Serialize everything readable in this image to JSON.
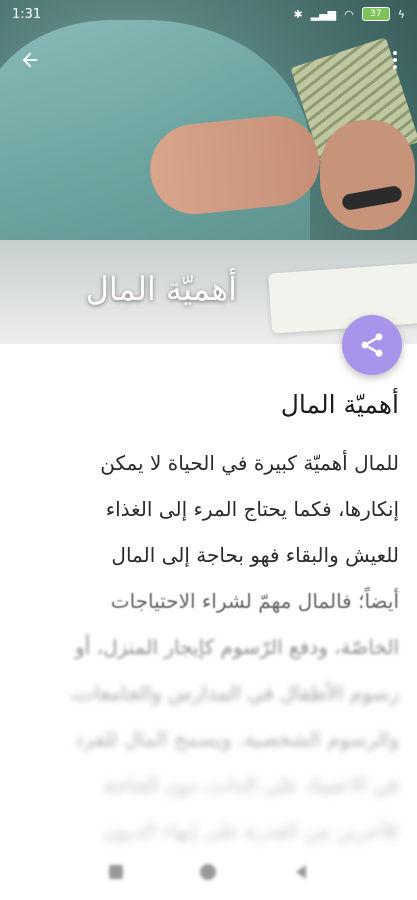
{
  "status_bar": {
    "time": "1:31",
    "battery_level": "37"
  },
  "hero": {
    "title": "أهميّة المال"
  },
  "article": {
    "title": "أهميّة المال",
    "lines": [
      "للمال أهميّة كبيرة في الحياة لا يمكن",
      "إنكارها، فكما يحتاج المرء إلى الغذاء",
      "للعيش والبقاء فهو بحاجة إلى المال",
      "أيضاً؛ فالمال مهمّ لشراء الاحتياجات",
      "الخاصّة، ودفع الرّسوم كإيجار المنزل، أو",
      "رسوم الأطفال في المدارس والجامعات،",
      "والرسوم الشخصية، ويسمح المال للفرد",
      "في الاعتماد على الذات، دون الحاجة",
      "للآخرين من القدرة على إنهاء الديون"
    ]
  },
  "icons": {
    "back": "arrow-back-icon",
    "more": "more-vert-icon",
    "share": "share-icon"
  },
  "colors": {
    "fab": "#a894ea",
    "battery": "#7cc35a"
  }
}
